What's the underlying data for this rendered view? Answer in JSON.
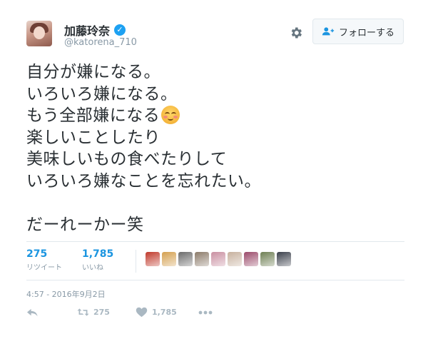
{
  "user": {
    "display_name": "加藤玲奈",
    "username": "@katorena_710",
    "verified": true
  },
  "header": {
    "follow_label": "フォローする"
  },
  "tweet": {
    "lines": [
      "自分が嫌になる。",
      "いろいろ嫌になる。",
      "もう全部嫌になる",
      "楽しいことしたり",
      "美味しいもの食べたりして",
      "いろいろ嫌なことを忘れたい。",
      "",
      "だーれーかー笑"
    ],
    "emoji": "smiling-face-with-blush"
  },
  "stats": {
    "retweets": {
      "count": "275",
      "label": "リツイート"
    },
    "likes": {
      "count": "1,785",
      "label": "いいね"
    }
  },
  "likers": [
    "#c0392b",
    "#d4a04f",
    "#6b6b6b",
    "#8c7b6a",
    "#c98fa1",
    "#c7b19e",
    "#9b4a6a",
    "#6e7f53",
    "#3a3f4a"
  ],
  "timestamp": "4:57 - 2016年9月2日",
  "actions": {
    "reply_icon": "reply-icon",
    "retweet_count": "275",
    "like_count": "1,785",
    "more_icon": "more-icon"
  },
  "colors": {
    "accent": "#1b95e0",
    "text": "#292f33",
    "muted": "#8899a6",
    "verified": "#1da1f2"
  }
}
